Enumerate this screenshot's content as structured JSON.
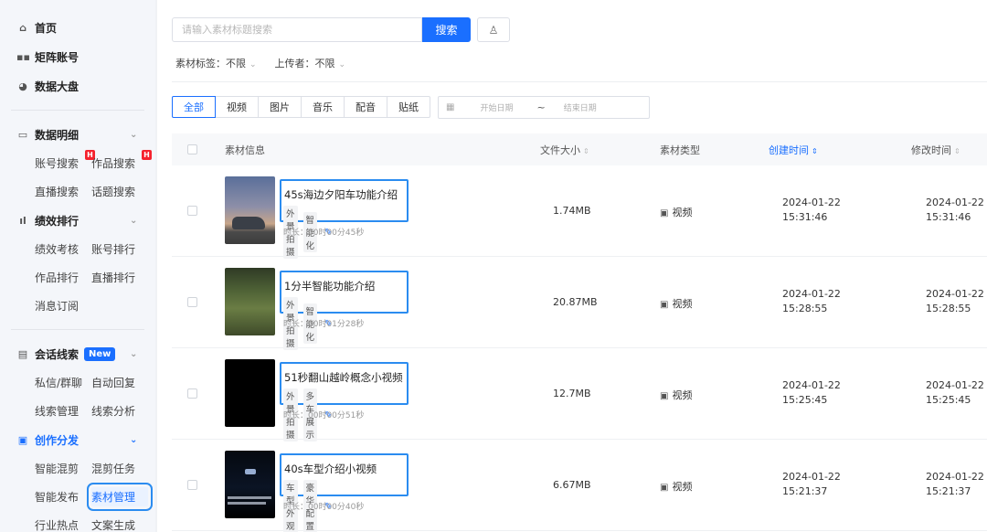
{
  "sidebar": {
    "top": [
      {
        "label": "首页",
        "icon": "home-icon"
      },
      {
        "label": "矩阵账号",
        "icon": "grid-icon"
      },
      {
        "label": "数据大盘",
        "icon": "pie-chart-icon"
      }
    ],
    "data_detail": {
      "label": "数据明细",
      "rows": [
        [
          "账号搜索",
          "作品搜索"
        ],
        [
          "直播搜索",
          "话题搜索"
        ]
      ],
      "badge": "H"
    },
    "performance": {
      "label": "绩效排行",
      "rows": [
        [
          "绩效考核",
          "账号排行"
        ],
        [
          "作品排行",
          "直播排行"
        ],
        [
          "消息订阅"
        ]
      ]
    },
    "leads": {
      "label": "会话线索",
      "badge": "New",
      "rows": [
        [
          "私信/群聊",
          "自动回复"
        ],
        [
          "线索管理",
          "线索分析"
        ]
      ]
    },
    "creation": {
      "label": "创作分发",
      "rows": [
        [
          "智能混剪",
          "混剪任务"
        ],
        [
          "智能发布",
          "素材管理"
        ],
        [
          "行业热点",
          "文案生成"
        ]
      ]
    }
  },
  "search": {
    "placeholder": "请输入素材标题搜索",
    "button": "搜索"
  },
  "filters": {
    "tag": "素材标签：不限",
    "uploader": "上传者：不限"
  },
  "type_tabs": [
    "全部",
    "视频",
    "图片",
    "音乐",
    "配音",
    "贴纸"
  ],
  "date_range": {
    "start": "开始日期",
    "sep": "~",
    "end": "结束日期"
  },
  "table": {
    "headers": {
      "info": "素材信息",
      "size": "文件大小",
      "type": "素材类型",
      "created": "创建时间",
      "modified": "修改时间"
    },
    "rows": [
      {
        "title": "45s海边夕阳车功能介绍",
        "tags": [
          "外景拍摄",
          "智能化"
        ],
        "duration": "时长：00时00分45秒",
        "size": "1.74MB",
        "type": "视频",
        "created_date": "2024-01-22",
        "created_time": "15:31:46",
        "modified_date": "2024-01-22",
        "modified_time": "15:31:46"
      },
      {
        "title": "1分半智能功能介绍",
        "tags": [
          "外景拍摄",
          "智能化"
        ],
        "duration": "时长：00时01分28秒",
        "size": "20.87MB",
        "type": "视频",
        "created_date": "2024-01-22",
        "created_time": "15:28:55",
        "modified_date": "2024-01-22",
        "modified_time": "15:28:55"
      },
      {
        "title": "51秒翻山越岭概念小视频",
        "tags": [
          "外景拍摄",
          "多车展示"
        ],
        "duration": "时长：00时00分51秒",
        "size": "12.7MB",
        "type": "视频",
        "created_date": "2024-01-22",
        "created_time": "15:25:45",
        "modified_date": "2024-01-22",
        "modified_time": "15:25:45"
      },
      {
        "title": "40s车型介绍小视频",
        "tags": [
          "车型外观",
          "豪华配置"
        ],
        "duration": "时长：00时00分40秒",
        "size": "6.67MB",
        "type": "视频",
        "created_date": "2024-01-22",
        "created_time": "15:21:37",
        "modified_date": "2024-01-22",
        "modified_time": "15:21:37"
      }
    ]
  },
  "colors": {
    "accent": "#1a6fff",
    "highlight": "#2b8cf0",
    "badge": "#f5222d"
  }
}
